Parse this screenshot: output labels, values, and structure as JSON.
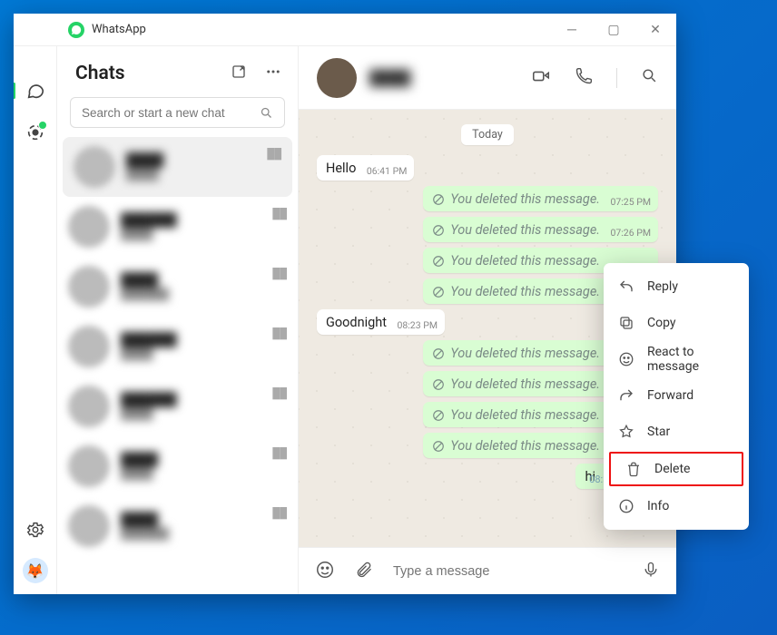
{
  "app": {
    "title": "WhatsApp"
  },
  "sidebar": {
    "title": "Chats",
    "search_placeholder": "Search or start a new chat"
  },
  "conversation": {
    "day_label": "Today",
    "composer_placeholder": "Type a message",
    "messages": [
      {
        "dir": "in",
        "text": "Hello",
        "time": "06:41 PM"
      },
      {
        "dir": "out",
        "deleted": true,
        "text": "You deleted this message.",
        "time": "07:25 PM"
      },
      {
        "dir": "out",
        "deleted": true,
        "text": "You deleted this message.",
        "time": "07:26 PM"
      },
      {
        "dir": "out",
        "deleted": true,
        "text": "You deleted this message.",
        "time": ""
      },
      {
        "dir": "out",
        "deleted": true,
        "text": "You deleted this message.",
        "time": ""
      },
      {
        "dir": "in",
        "text": "Goodnight",
        "time": "08:23 PM"
      },
      {
        "dir": "out",
        "deleted": true,
        "text": "You deleted this message.",
        "time": ""
      },
      {
        "dir": "out",
        "deleted": true,
        "text": "You deleted this message.",
        "time": ""
      },
      {
        "dir": "out",
        "deleted": true,
        "text": "You deleted this message.",
        "time": ""
      },
      {
        "dir": "out",
        "deleted": true,
        "text": "You deleted this message.",
        "time": ""
      },
      {
        "dir": "out",
        "text": "hi",
        "time": "08:35 PM",
        "ticks": true
      }
    ]
  },
  "context_menu": {
    "items": [
      {
        "icon": "reply",
        "label": "Reply"
      },
      {
        "icon": "copy",
        "label": "Copy"
      },
      {
        "icon": "react",
        "label": "React to message"
      },
      {
        "icon": "forward",
        "label": "Forward"
      },
      {
        "icon": "star",
        "label": "Star"
      },
      {
        "icon": "delete",
        "label": "Delete",
        "highlight": true
      },
      {
        "icon": "info",
        "label": "Info"
      }
    ]
  }
}
